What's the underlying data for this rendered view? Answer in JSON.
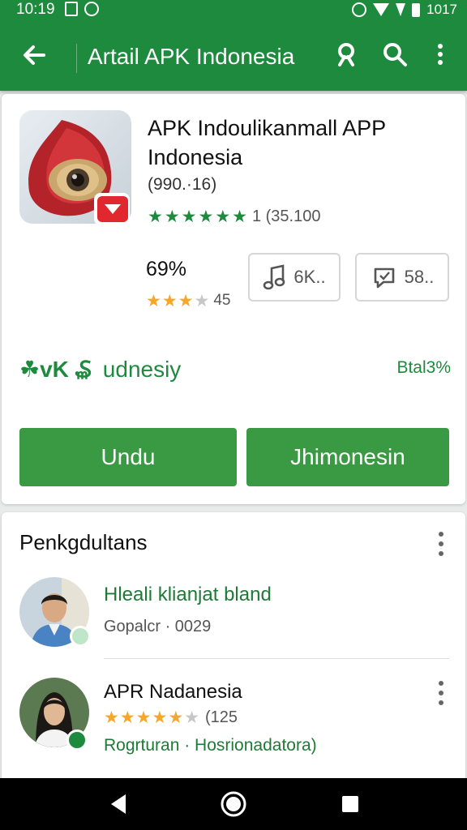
{
  "status_bar": {
    "time": "10:19",
    "battery_text": "1017"
  },
  "app_bar": {
    "title": "Artail APK Indonesia"
  },
  "app": {
    "name": "APK Indoulikanmall APP Indonesia",
    "version": "(990.·16)",
    "review_count": "1 (35.100",
    "percent": "69%",
    "small_rating_count": "45",
    "chip1_label": "6K..",
    "chip2_label": "58..",
    "brand_logo": "☘vK ₷",
    "brand_text": "udnesiy",
    "brand_right": "Btal3%",
    "primary_button": "Undu",
    "secondary_button": "Jhimonesin"
  },
  "reviews_section": {
    "title": "Penkgdultans",
    "items": [
      {
        "name": "Hleali klianjat bland",
        "meta": "Gopalcr · 0029",
        "name_color": "#1e7a36"
      },
      {
        "name": "APR Nadanesia",
        "rating_count": "(125",
        "meta": "Rogrturan · Hosrionadatora)",
        "meta_color": "#1e7a36"
      }
    ]
  },
  "colors": {
    "primary": "#1e8a3e",
    "button": "#3a9a43",
    "star_green": "#1e8a3e",
    "star_orange": "#f4a72b"
  },
  "icons": [
    "back-arrow-icon",
    "account-icon",
    "search-icon",
    "more-vert-icon",
    "music-note-icon",
    "chat-bubble-icon",
    "nav-back-icon",
    "nav-home-icon",
    "nav-recents-icon"
  ]
}
